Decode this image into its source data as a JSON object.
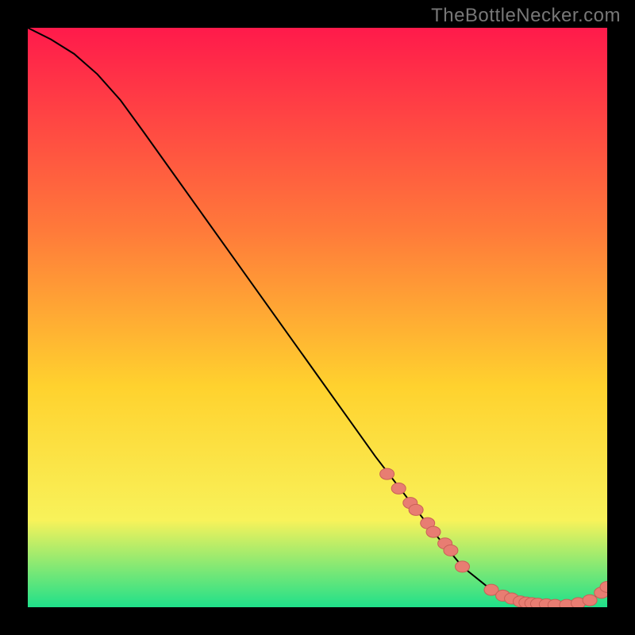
{
  "watermark": "TheBottleNecker.com",
  "colors": {
    "gradient_top": "#ff1a4b",
    "gradient_mid1": "#ff7a3a",
    "gradient_mid2": "#ffd22e",
    "gradient_mid3": "#f8f25a",
    "gradient_bottom": "#1fe08a",
    "curve": "#000000",
    "marker_fill": "#e87d72",
    "marker_stroke": "#c96057"
  },
  "chart_data": {
    "type": "line",
    "title": "",
    "xlabel": "",
    "ylabel": "",
    "xlim": [
      0,
      100
    ],
    "ylim": [
      0,
      100
    ],
    "series": [
      {
        "name": "bottleneck-curve",
        "x": [
          0,
          4,
          8,
          12,
          16,
          20,
          25,
          30,
          35,
          40,
          45,
          50,
          55,
          60,
          65,
          70,
          75,
          80,
          83,
          85,
          87,
          89,
          91,
          93,
          95,
          97,
          99,
          100
        ],
        "y": [
          100,
          98,
          95.5,
          92,
          87.5,
          82,
          75,
          68,
          61,
          54,
          47,
          40,
          33,
          26,
          19.5,
          13,
          7,
          3,
          1.5,
          1,
          0.7,
          0.5,
          0.4,
          0.4,
          0.7,
          1.2,
          2.5,
          3.5
        ]
      }
    ],
    "markers": {
      "name": "highlighted-points",
      "x": [
        62,
        64,
        66,
        67,
        69,
        70,
        72,
        73,
        75,
        80,
        82,
        83.5,
        85,
        86,
        87,
        88,
        89.5,
        91,
        93,
        95,
        97,
        99,
        100
      ],
      "y": [
        23,
        20.5,
        18,
        16.8,
        14.5,
        13,
        11,
        9.8,
        7,
        3,
        2,
        1.5,
        1,
        0.8,
        0.7,
        0.6,
        0.5,
        0.4,
        0.4,
        0.7,
        1.2,
        2.5,
        3.5
      ]
    }
  }
}
